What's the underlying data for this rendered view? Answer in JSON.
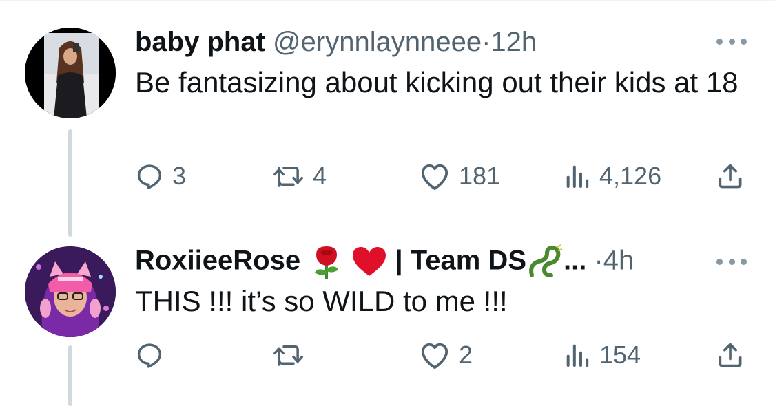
{
  "tweets": [
    {
      "name": "baby phat",
      "handle": "@erynnlaynneee",
      "separator": "·",
      "time": "12h",
      "text": "Be fantasizing about kicking out their kids at 18",
      "replies": "3",
      "retweets": "4",
      "likes": "181",
      "views": "4,126"
    },
    {
      "name_before": "RoxiieeRose",
      "name_after": "| Team DS",
      "name_ellipsis": "...",
      "separator": "·",
      "time": "4h",
      "text": "THIS !!! it’s so WILD to me !!!",
      "replies": "",
      "retweets": "",
      "likes": "2",
      "views": "154"
    }
  ],
  "icons": {
    "reply": "reply-icon",
    "retweet": "retweet-icon",
    "like": "heart-icon",
    "views": "views-icon",
    "share": "share-icon",
    "more": "more-icon"
  },
  "colors": {
    "text": "#0f1419",
    "secondary": "#536471",
    "thread_line": "#cfd9de",
    "rose": "#d01020",
    "heart": "#e0102a",
    "dragon": "#4a8a2e"
  }
}
